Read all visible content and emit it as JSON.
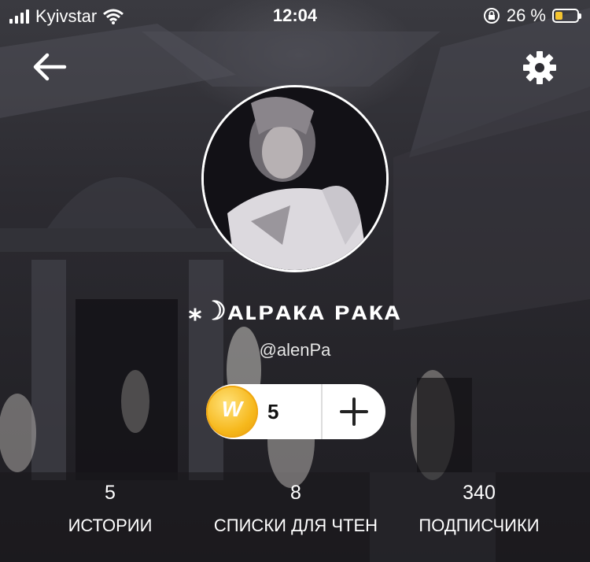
{
  "status_bar": {
    "carrier": "Kyivstar",
    "time": "12:04",
    "battery_percent": "26 %"
  },
  "profile": {
    "display_name": "⁎☽ᴀʟᴘᴀᴋᴀ ᴘᴀᴋᴀ",
    "username": "@alenPa"
  },
  "coins": {
    "icon_letter": "W",
    "count": "5"
  },
  "stats": [
    {
      "value": "5",
      "label": "ИСТОРИИ"
    },
    {
      "value": "8",
      "label": "СПИСКИ ДЛЯ ЧТЕН"
    },
    {
      "value": "340",
      "label": "ПОДПИСЧИКИ"
    }
  ],
  "colors": {
    "coin_gold": "#f6b81c",
    "battery_fill": "#f4c430",
    "text": "#ffffff"
  },
  "icons": {
    "back": "arrow-left",
    "settings": "gear"
  }
}
